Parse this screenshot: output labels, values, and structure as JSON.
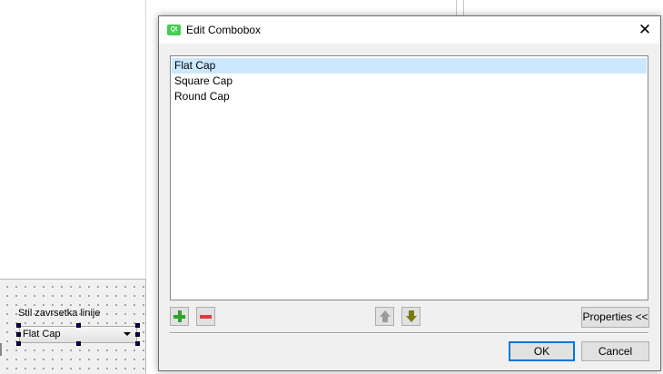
{
  "designer": {
    "form_label": "Stil zavrsetka linije",
    "combo_value": "Flat Cap"
  },
  "dialog": {
    "title": "Edit Combobox",
    "close_glyph": "✕",
    "app_icon_text": "Qt",
    "items": [
      {
        "label": "Flat Cap",
        "selected": true
      },
      {
        "label": "Square Cap",
        "selected": false
      },
      {
        "label": "Round Cap",
        "selected": false
      }
    ],
    "properties_label": "Properties <<",
    "ok_label": "OK",
    "cancel_label": "Cancel"
  },
  "colors": {
    "selection": "#cce8ff",
    "default_button_border": "#0078d7",
    "add_icon": "#2ea42e",
    "remove_icon": "#e0383e"
  },
  "icons": [
    "qt-app-icon",
    "close-icon",
    "add-icon",
    "remove-icon",
    "move-up-icon",
    "move-down-icon",
    "dropdown-arrow-icon"
  ]
}
